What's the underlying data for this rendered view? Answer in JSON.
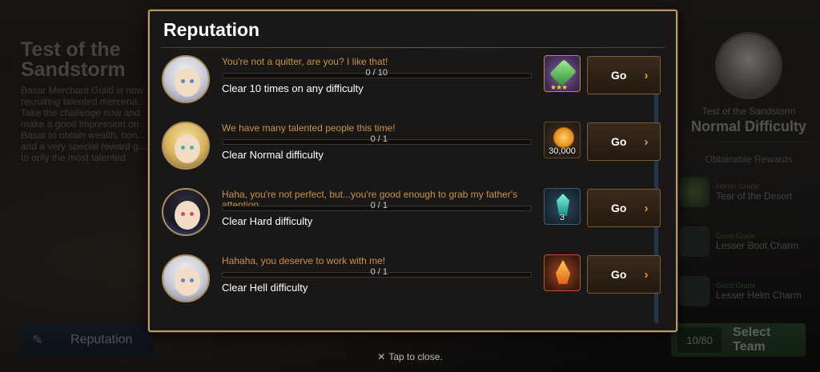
{
  "background": {
    "left_panel": {
      "title": "Test of the Sandstorm",
      "description": "Basar Merchant Guild is now recruiting talented mercena... Take the challenge now and make a good impression on Basar to obtain wealth, hon... and a very special reward g... to only the most talented"
    },
    "reputation_tab": {
      "label": "Reputation",
      "icon": "scroll-icon"
    },
    "right_panel": {
      "subtitle": "Test of the Sandstorm",
      "difficulty": "Normal Difficulty",
      "rewards_label": "Obtainable Rewards",
      "rewards": [
        {
          "grade": "Heroic Grade",
          "name": "Tear of the Desert"
        },
        {
          "grade": "Good Grade",
          "name": "Lesser Boot Charm"
        },
        {
          "grade": "Good Grade",
          "name": "Lesser Helm Charm"
        }
      ],
      "team_count": "10/80",
      "select_team_label": "Select Team"
    }
  },
  "modal": {
    "title": "Reputation",
    "quests": [
      {
        "quote": "You're not a quitter, are you? I like that!",
        "progress_text": "0 / 10",
        "progress": 0,
        "condition": "Clear 10 times on any difficulty",
        "reward_icon": "green-gem-icon",
        "reward_stars": "★★★",
        "reward_qty": "",
        "go_label": "Go"
      },
      {
        "quote": "We have many talented people this time!",
        "progress_text": "0 / 1",
        "progress": 0,
        "condition": "Clear Normal difficulty",
        "reward_icon": "gold-coin-icon",
        "reward_stars": "",
        "reward_qty": "30,000",
        "go_label": "Go"
      },
      {
        "quote": "Haha, you're not perfect, but...you're good enough to grab my father's attention.",
        "progress_text": "0 / 1",
        "progress": 0,
        "condition": "Clear Hard difficulty",
        "reward_icon": "crystal-icon",
        "reward_stars": "",
        "reward_qty": "3",
        "go_label": "Go"
      },
      {
        "quote": "Hahaha, you deserve to work with me!",
        "progress_text": "0 / 1",
        "progress": 0,
        "condition": "Clear Hell difficulty",
        "reward_icon": "flame-charm-icon",
        "reward_stars": "",
        "reward_qty": "",
        "go_label": "Go"
      }
    ],
    "close_hint": "Tap to close.",
    "close_icon": "close-icon"
  },
  "colors": {
    "accent_gold": "#b59a6a",
    "quote_orange": "#c8924c",
    "panel_bg": "#1a1816"
  }
}
